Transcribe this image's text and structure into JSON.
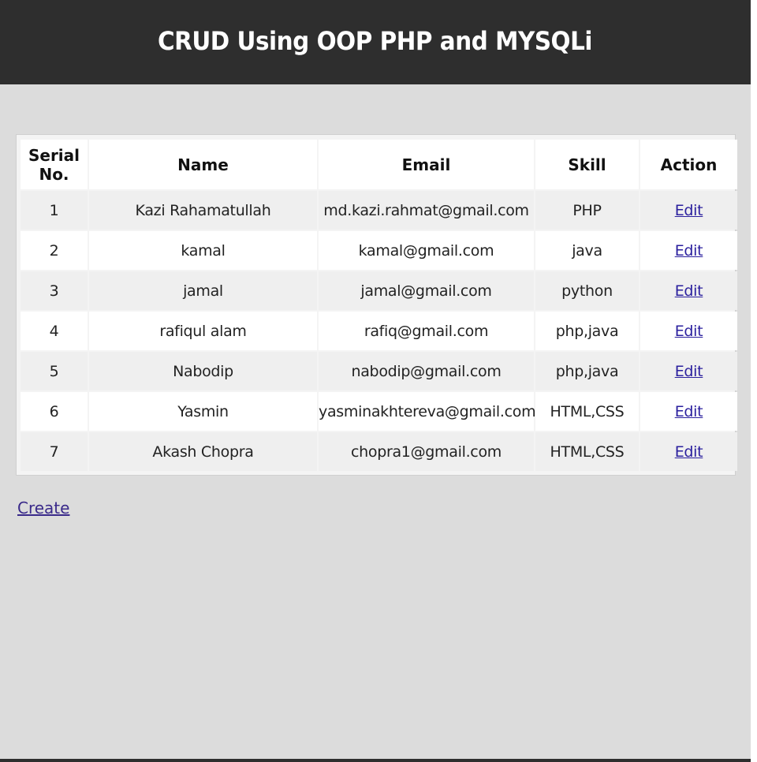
{
  "header": {
    "title": "CRUD Using OOP PHP and MYSQLi"
  },
  "table": {
    "columns": [
      "Serial No.",
      "Name",
      "Email",
      "Skill",
      "Action"
    ],
    "rows": [
      {
        "serial": "1",
        "name": "Kazi Rahamatullah",
        "email": "md.kazi.rahmat@gmail.com",
        "skill": "PHP",
        "action": "Edit"
      },
      {
        "serial": "2",
        "name": "kamal",
        "email": "kamal@gmail.com",
        "skill": "java",
        "action": "Edit"
      },
      {
        "serial": "3",
        "name": "jamal",
        "email": "jamal@gmail.com",
        "skill": "python",
        "action": "Edit"
      },
      {
        "serial": "4",
        "name": "rafiqul alam",
        "email": "rafiq@gmail.com",
        "skill": "php,java",
        "action": "Edit"
      },
      {
        "serial": "5",
        "name": "Nabodip",
        "email": "nabodip@gmail.com",
        "skill": "php,java",
        "action": "Edit"
      },
      {
        "serial": "6",
        "name": "Yasmin",
        "email": "yasminakhtereva@gmail.com",
        "skill": "HTML,CSS",
        "action": "Edit"
      },
      {
        "serial": "7",
        "name": "Akash Chopra",
        "email": "chopra1@gmail.com",
        "skill": "HTML,CSS",
        "action": "Edit"
      }
    ]
  },
  "create_link": "Create",
  "colors": {
    "header_bg": "#2e2e2e",
    "page_bg": "#dcdcdc",
    "link": "#2a1f9e"
  }
}
